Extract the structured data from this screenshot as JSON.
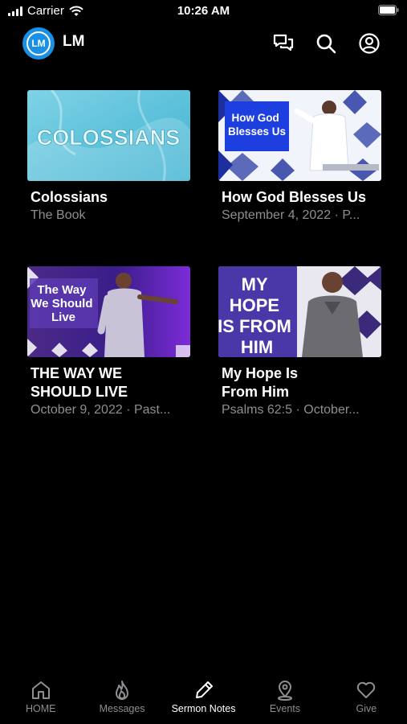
{
  "status_bar": {
    "carrier": "Carrier",
    "time": "10:26 AM"
  },
  "header": {
    "logo_text": "LM",
    "app_name": "LM",
    "icons": [
      "chat-icon",
      "search-icon",
      "account-icon"
    ]
  },
  "cards": [
    {
      "title": "Colossians",
      "subtitle": "The Book",
      "thumb_text": "COLOSSIANS"
    },
    {
      "title": "How God Blesses Us",
      "subtitle": "September 4, 2022 · P...",
      "thumb_text": "How God\nBlesses Us"
    },
    {
      "title": "THE WAY WE\nSHOULD LIVE",
      "subtitle": "October 9, 2022 · Past...",
      "thumb_text": "The Way\nWe Should\nLive"
    },
    {
      "title": "My Hope Is\nFrom Him",
      "subtitle": "Psalms 62:5 · October...",
      "thumb_text": "MY\nHOPE\nIS FROM\nHIM"
    }
  ],
  "tabs": [
    {
      "label": "HOME",
      "icon": "home-icon",
      "active": false
    },
    {
      "label": "Messages",
      "icon": "flame-icon",
      "active": false
    },
    {
      "label": "Sermon Notes",
      "icon": "pencil-icon",
      "active": true
    },
    {
      "label": "Events",
      "icon": "location-pin-icon",
      "active": false
    },
    {
      "label": "Give",
      "icon": "heart-icon",
      "active": false
    }
  ],
  "colors": {
    "background": "#000000",
    "accent": "#1a8fe6",
    "inactive": "#8e8e93"
  }
}
